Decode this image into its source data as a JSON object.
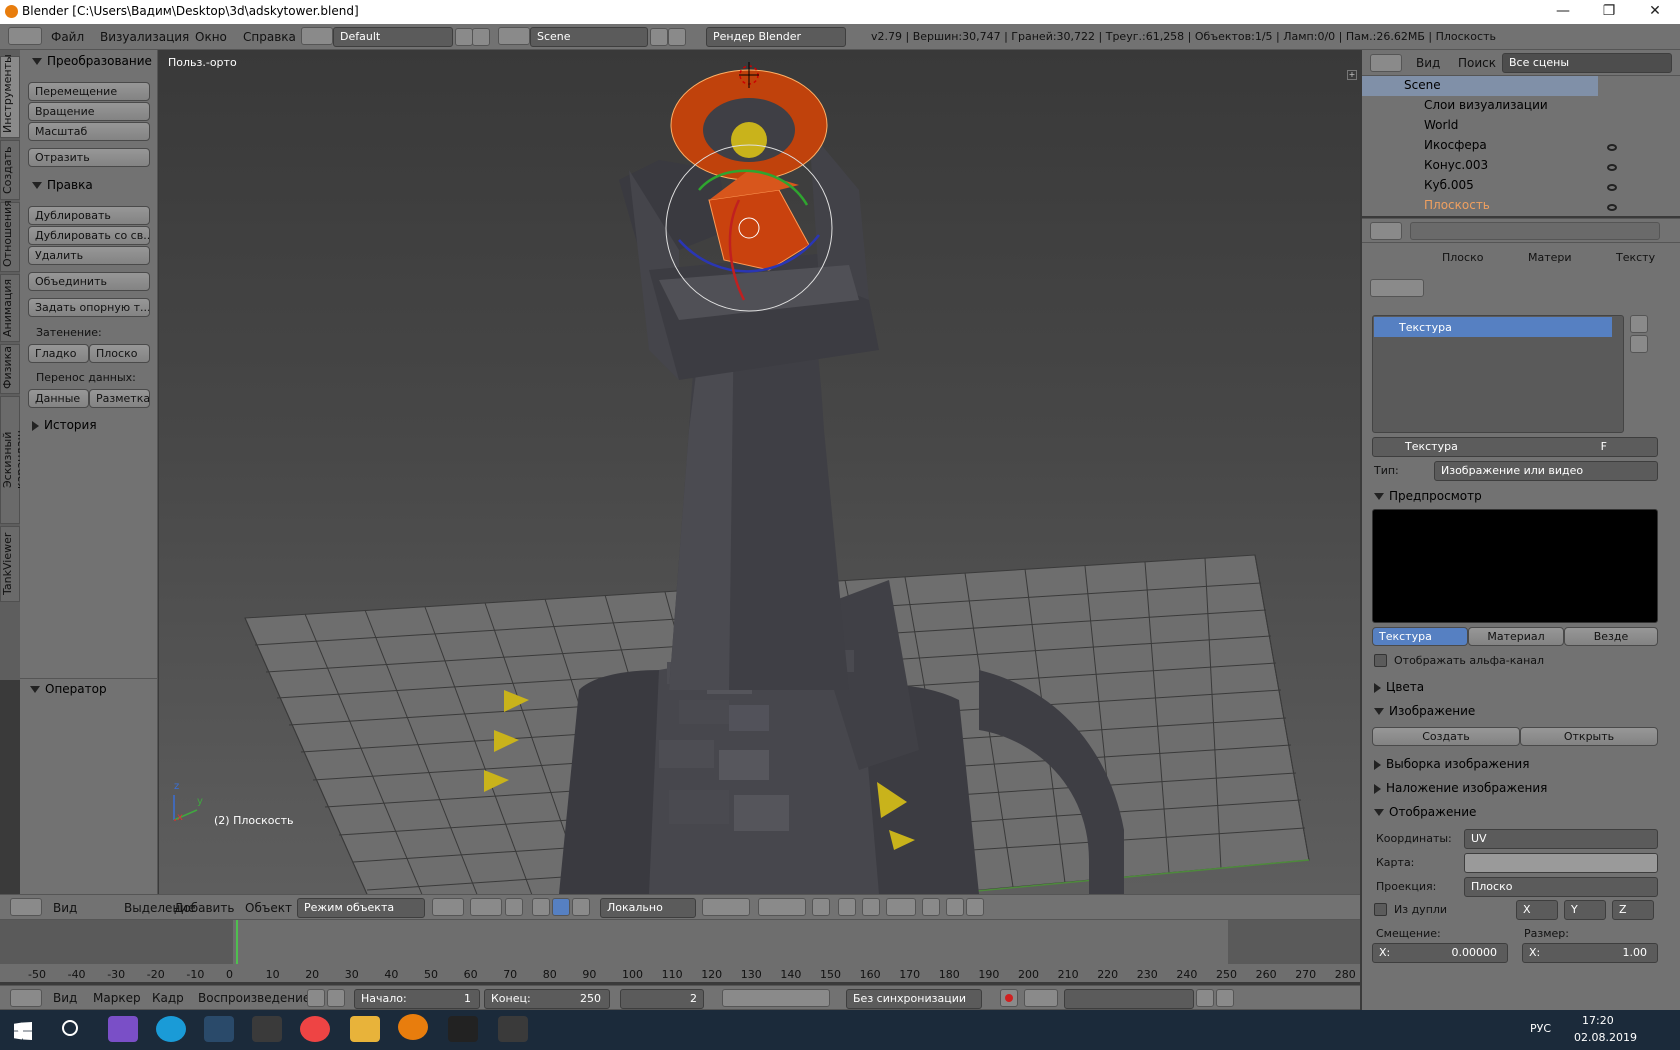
{
  "titlebar": {
    "title": "Blender [C:\\Users\\Вадим\\Desktop\\3d\\adskytower.blend]",
    "minimize": "—",
    "maximize": "❐",
    "close": "✕"
  },
  "info_header": {
    "menus": [
      "Файл",
      "Визуализация",
      "Окно",
      "Справка"
    ],
    "screen_layout": "Default",
    "scene": "Scene",
    "render_engine": "Рендер Blender",
    "stats": "v2.79 | Вершин:30,747 | Граней:30,722 | Треуг.:61,258 | Объектов:1/5 | Ламп:0/0 | Пам.:26.62МБ | Плоскость"
  },
  "tool_tabs": [
    "Инструменты",
    "Создать",
    "Отношения",
    "Анимация",
    "Физика",
    "Эскизный карандаш",
    "TankViewer"
  ],
  "toolshelf": {
    "transform_header": "Преобразование",
    "transform_buttons": [
      "Перемещение",
      "Вращение",
      "Масштаб"
    ],
    "mirror": "Отразить",
    "edit_header": "Правка",
    "edit_buttons": [
      "Дублировать",
      "Дублировать со св...",
      "Удалить"
    ],
    "join": "Объединить",
    "set_origin": "Задать опорную т...",
    "shading_label": "Затенение:",
    "shading_smooth": "Гладко",
    "shading_flat": "Плоско",
    "data_transfer_label": "Перенос данных:",
    "data_btn": "Данные",
    "layout_btn": "Разметка",
    "history_header": "История",
    "operator_header": "Оператор"
  },
  "viewport": {
    "view_label": "Польз.-орто",
    "object_label": "(2) Плоскость",
    "axis_z": "z",
    "axis_y": "y",
    "axis_x": "x"
  },
  "viewport_header": {
    "menus": [
      "Вид",
      "Выделение",
      "Добавить",
      "Объект"
    ],
    "mode": "Режим объекта",
    "orientation": "Локально"
  },
  "timeline": {
    "ticks": [
      "-50",
      "-40",
      "-30",
      "-20",
      "-10",
      "0",
      "10",
      "20",
      "30",
      "40",
      "50",
      "60",
      "70",
      "80",
      "90",
      "100",
      "110",
      "120",
      "130",
      "140",
      "150",
      "160",
      "170",
      "180",
      "190",
      "200",
      "210",
      "220",
      "230",
      "240",
      "250",
      "260",
      "270",
      "280"
    ],
    "menus": [
      "Вид",
      "Маркер",
      "Кадр",
      "Воспроизведение"
    ],
    "start_label": "Начало:",
    "start_value": "1",
    "end_label": "Конец:",
    "end_value": "250",
    "current_frame": "2",
    "sync": "Без синхронизации",
    "current_frame_value": 2
  },
  "outliner": {
    "menus": [
      "Вид",
      "Поиск"
    ],
    "filter": "Все сцены",
    "items": [
      {
        "label": "Scene"
      },
      {
        "label": "Слои визуализации"
      },
      {
        "label": "World"
      },
      {
        "label": "Икосфера"
      },
      {
        "label": "Конус.003"
      },
      {
        "label": "Куб.005"
      },
      {
        "label": "Плоскость"
      }
    ]
  },
  "properties": {
    "breadcrumb": [
      "Плоско",
      "Матери",
      "Тексту"
    ],
    "texture_slot": "Текстура",
    "texture_name": "Текстура",
    "fake_user": "F",
    "type_label": "Тип:",
    "type_value": "Изображение или видео",
    "preview_header": "Предпросмотр",
    "preview_tabs": [
      "Текстура",
      "Материал",
      "Везде"
    ],
    "show_alpha": "Отображать альфа-канал",
    "colors_header": "Цвета",
    "image_header": "Изображение",
    "create_btn": "Создать",
    "open_btn": "Открыть",
    "image_sampling_header": "Выборка изображения",
    "image_mapping_header": "Наложение изображения",
    "mapping_header": "Отображение",
    "coords_label": "Координаты:",
    "coords_value": "UV",
    "map_label": "Карта:",
    "projection_label": "Проекция:",
    "projection_value": "Плоско",
    "from_dupli": "Из дупли",
    "axes": [
      "X",
      "Y",
      "Z"
    ],
    "offset_label": "Смещение:",
    "offset_x": "X:",
    "offset_x_value": "0.00000",
    "size_label": "Размер:",
    "size_x": "X:",
    "size_x_value": "1.00"
  },
  "taskbar": {
    "lang": "РУС",
    "time": "17:20",
    "date": "02.08.2019"
  },
  "colors": {
    "selection": "#e86a13",
    "accent": "#5680c2",
    "panel": "#727272",
    "viewport": "#393939"
  }
}
